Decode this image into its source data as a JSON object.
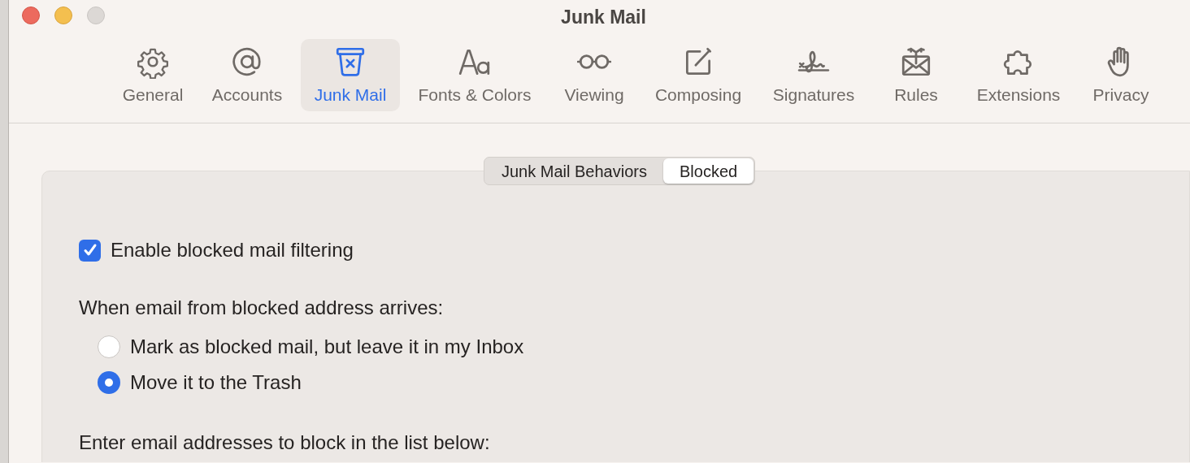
{
  "window": {
    "title": "Junk Mail"
  },
  "toolbar": [
    {
      "label": "General",
      "selected": false
    },
    {
      "label": "Accounts",
      "selected": false
    },
    {
      "label": "Junk Mail",
      "selected": true
    },
    {
      "label": "Fonts & Colors",
      "selected": false
    },
    {
      "label": "Viewing",
      "selected": false
    },
    {
      "label": "Composing",
      "selected": false
    },
    {
      "label": "Signatures",
      "selected": false
    },
    {
      "label": "Rules",
      "selected": false
    },
    {
      "label": "Extensions",
      "selected": false
    },
    {
      "label": "Privacy",
      "selected": false
    }
  ],
  "segments": [
    {
      "label": "Junk Mail Behaviors",
      "selected": false
    },
    {
      "label": "Blocked",
      "selected": true
    }
  ],
  "filtering": {
    "label": "Enable blocked mail filtering",
    "checked": true
  },
  "action": {
    "heading": "When email from blocked address arrives:",
    "options": [
      {
        "label": "Mark as blocked mail, but leave it in my Inbox",
        "selected": false
      },
      {
        "label": "Move it to the Trash",
        "selected": true
      }
    ]
  },
  "list": {
    "heading": "Enter email addresses to block in the list below:"
  }
}
